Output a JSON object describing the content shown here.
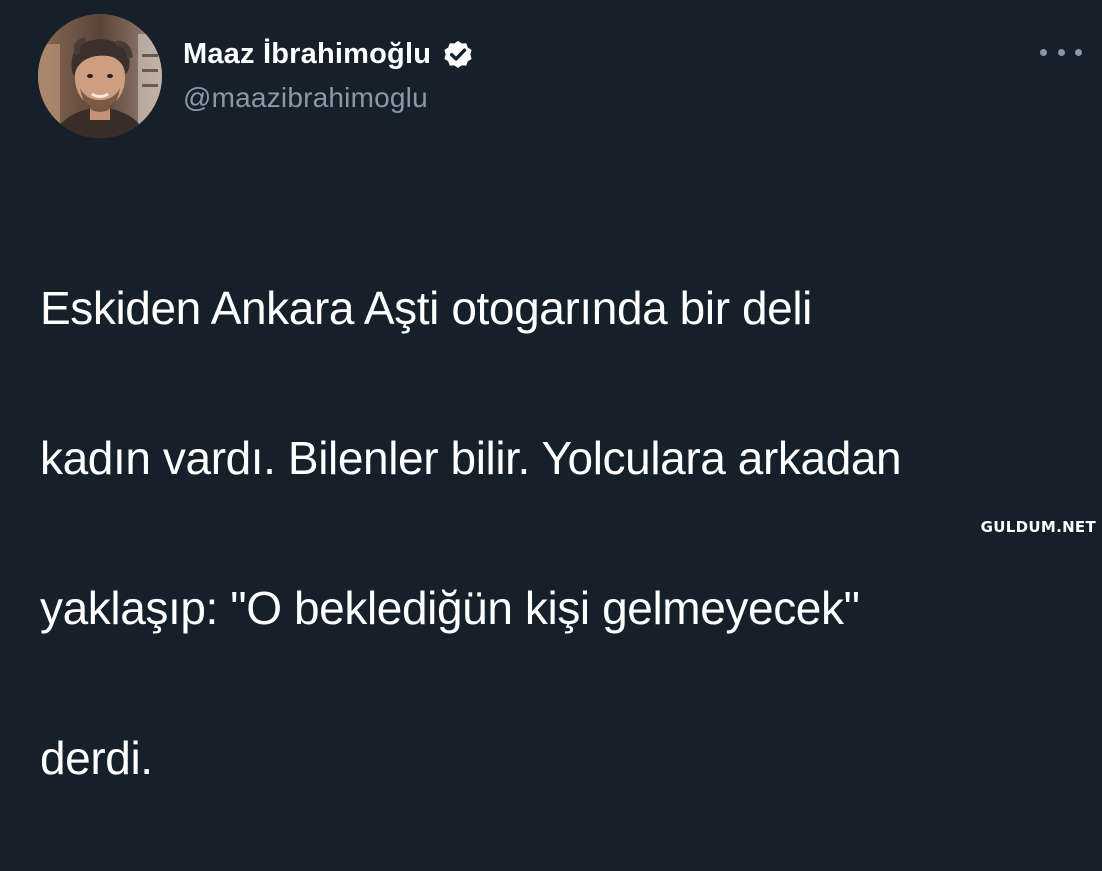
{
  "tweet": {
    "author": {
      "display_name": "Maaz İbrahimoğlu",
      "handle": "@maazibrahimoglu",
      "verified": true
    },
    "text_lines": [
      "Eskiden Ankara Aşti otogarında bir deli",
      "kadın vardı. Bilenler bilir.  Yolculara arkadan",
      "yaklaşıp: \"O beklediğün kişi gelmeyecek\"",
      "derdi."
    ],
    "more_icon": "more-horizontal-icon",
    "verified_icon": "verified-badge-icon"
  },
  "watermark": "GULDUM.NET",
  "colors": {
    "background": "#15202b",
    "text_primary": "#ffffff",
    "text_secondary": "#8b98a5"
  }
}
